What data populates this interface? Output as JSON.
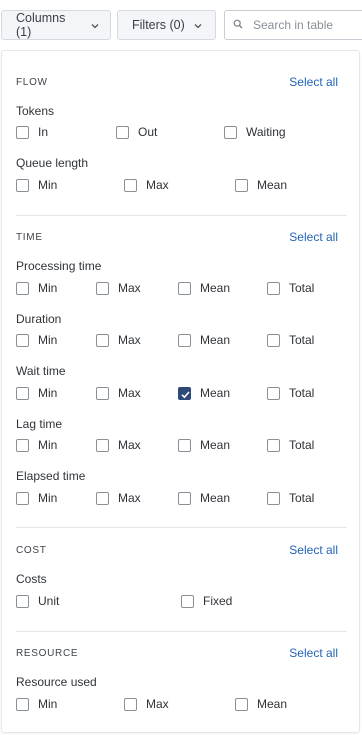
{
  "toolbar": {
    "columns_label": "Columns (1)",
    "filters_label": "Filters (0)",
    "search_placeholder": "Search in table"
  },
  "select_all_label": "Select all",
  "sections": {
    "flow": {
      "title": "FLOW",
      "groups": {
        "tokens": {
          "label": "Tokens",
          "options": [
            {
              "label": "In",
              "checked": false
            },
            {
              "label": "Out",
              "checked": false
            },
            {
              "label": "Waiting",
              "checked": false
            }
          ]
        },
        "queue_length": {
          "label": "Queue length",
          "options": [
            {
              "label": "Min",
              "checked": false
            },
            {
              "label": "Max",
              "checked": false
            },
            {
              "label": "Mean",
              "checked": false
            }
          ]
        }
      }
    },
    "time": {
      "title": "TIME",
      "groups": {
        "processing_time": {
          "label": "Processing time",
          "options": [
            {
              "label": "Min",
              "checked": false
            },
            {
              "label": "Max",
              "checked": false
            },
            {
              "label": "Mean",
              "checked": false
            },
            {
              "label": "Total",
              "checked": false
            }
          ]
        },
        "duration": {
          "label": "Duration",
          "options": [
            {
              "label": "Min",
              "checked": false
            },
            {
              "label": "Max",
              "checked": false
            },
            {
              "label": "Mean",
              "checked": false
            },
            {
              "label": "Total",
              "checked": false
            }
          ]
        },
        "wait_time": {
          "label": "Wait time",
          "options": [
            {
              "label": "Min",
              "checked": false
            },
            {
              "label": "Max",
              "checked": false
            },
            {
              "label": "Mean",
              "checked": true
            },
            {
              "label": "Total",
              "checked": false
            }
          ]
        },
        "lag_time": {
          "label": "Lag time",
          "options": [
            {
              "label": "Min",
              "checked": false
            },
            {
              "label": "Max",
              "checked": false
            },
            {
              "label": "Mean",
              "checked": false
            },
            {
              "label": "Total",
              "checked": false
            }
          ]
        },
        "elapsed_time": {
          "label": "Elapsed time",
          "options": [
            {
              "label": "Min",
              "checked": false
            },
            {
              "label": "Max",
              "checked": false
            },
            {
              "label": "Mean",
              "checked": false
            },
            {
              "label": "Total",
              "checked": false
            }
          ]
        }
      }
    },
    "cost": {
      "title": "COST",
      "groups": {
        "costs": {
          "label": "Costs",
          "options": [
            {
              "label": "Unit",
              "checked": false
            },
            {
              "label": "Fixed",
              "checked": false
            }
          ]
        }
      }
    },
    "resource": {
      "title": "RESOURCE",
      "groups": {
        "resource_used": {
          "label": "Resource used",
          "options": [
            {
              "label": "Min",
              "checked": false
            },
            {
              "label": "Max",
              "checked": false
            },
            {
              "label": "Mean",
              "checked": false
            }
          ]
        }
      }
    }
  },
  "colors": {
    "accent": "#2d4a78",
    "link": "#1f63b8"
  }
}
